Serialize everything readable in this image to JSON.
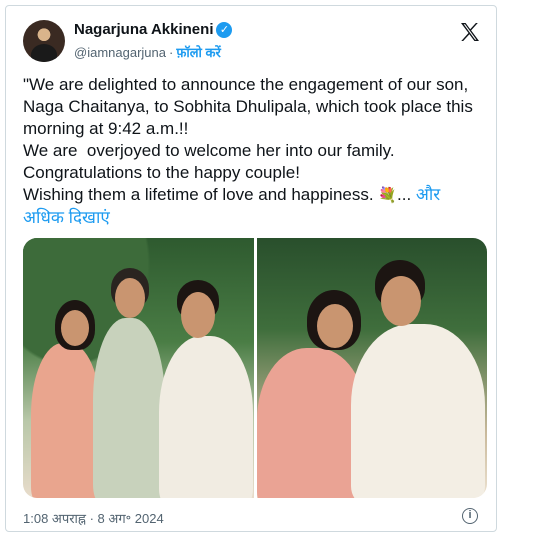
{
  "author": {
    "display_name": "Nagarjuna Akkineni",
    "handle": "@iamnagarjuna",
    "separator": "·",
    "follow_label": "फ़ॉलो करें",
    "verified_mark": "✓"
  },
  "tweet": {
    "text": "\"We are delighted to announce the engagement of our son, Naga Chaitanya, to Sobhita Dhulipala, which took place this morning at 9:42 a.m.!!\nWe are  overjoyed to welcome her into our family. Congratulations to the happy couple!\nWishing them a lifetime of love and happiness. ",
    "emoji": "💐",
    "ellipsis": "... ",
    "show_more_label": "और अधिक दिखाएं"
  },
  "media": {
    "photo_count": 2,
    "items": [
      "engagement-photo-1",
      "engagement-photo-2"
    ]
  },
  "footer": {
    "timestamp": "1:08 अपराह्न · 8 अग॰ 2024",
    "info_glyph": "i"
  },
  "icons": {
    "brand": "x-logo-icon",
    "verified": "verified-badge-icon",
    "info": "info-icon"
  },
  "colors": {
    "accent": "#1d9bf0",
    "text": "#0f1419",
    "muted": "#536471",
    "border": "#cfd9de"
  }
}
